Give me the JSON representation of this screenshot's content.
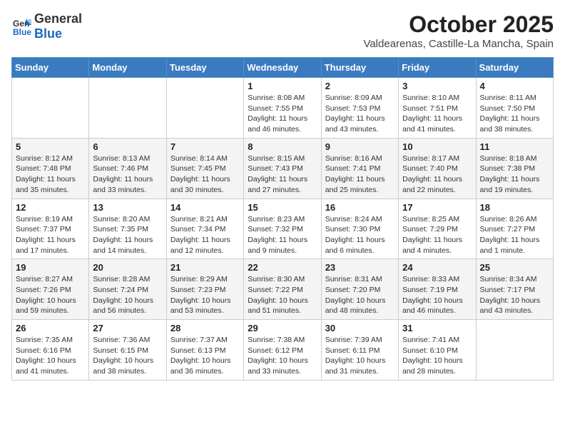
{
  "header": {
    "logo": {
      "general": "General",
      "blue": "Blue"
    },
    "month_title": "October 2025",
    "subtitle": "Valdearenas, Castille-La Mancha, Spain"
  },
  "weekdays": [
    "Sunday",
    "Monday",
    "Tuesday",
    "Wednesday",
    "Thursday",
    "Friday",
    "Saturday"
  ],
  "weeks": [
    [
      {
        "day": "",
        "info": ""
      },
      {
        "day": "",
        "info": ""
      },
      {
        "day": "",
        "info": ""
      },
      {
        "day": "1",
        "info": "Sunrise: 8:08 AM\nSunset: 7:55 PM\nDaylight: 11 hours\nand 46 minutes."
      },
      {
        "day": "2",
        "info": "Sunrise: 8:09 AM\nSunset: 7:53 PM\nDaylight: 11 hours\nand 43 minutes."
      },
      {
        "day": "3",
        "info": "Sunrise: 8:10 AM\nSunset: 7:51 PM\nDaylight: 11 hours\nand 41 minutes."
      },
      {
        "day": "4",
        "info": "Sunrise: 8:11 AM\nSunset: 7:50 PM\nDaylight: 11 hours\nand 38 minutes."
      }
    ],
    [
      {
        "day": "5",
        "info": "Sunrise: 8:12 AM\nSunset: 7:48 PM\nDaylight: 11 hours\nand 35 minutes."
      },
      {
        "day": "6",
        "info": "Sunrise: 8:13 AM\nSunset: 7:46 PM\nDaylight: 11 hours\nand 33 minutes."
      },
      {
        "day": "7",
        "info": "Sunrise: 8:14 AM\nSunset: 7:45 PM\nDaylight: 11 hours\nand 30 minutes."
      },
      {
        "day": "8",
        "info": "Sunrise: 8:15 AM\nSunset: 7:43 PM\nDaylight: 11 hours\nand 27 minutes."
      },
      {
        "day": "9",
        "info": "Sunrise: 8:16 AM\nSunset: 7:41 PM\nDaylight: 11 hours\nand 25 minutes."
      },
      {
        "day": "10",
        "info": "Sunrise: 8:17 AM\nSunset: 7:40 PM\nDaylight: 11 hours\nand 22 minutes."
      },
      {
        "day": "11",
        "info": "Sunrise: 8:18 AM\nSunset: 7:38 PM\nDaylight: 11 hours\nand 19 minutes."
      }
    ],
    [
      {
        "day": "12",
        "info": "Sunrise: 8:19 AM\nSunset: 7:37 PM\nDaylight: 11 hours\nand 17 minutes."
      },
      {
        "day": "13",
        "info": "Sunrise: 8:20 AM\nSunset: 7:35 PM\nDaylight: 11 hours\nand 14 minutes."
      },
      {
        "day": "14",
        "info": "Sunrise: 8:21 AM\nSunset: 7:34 PM\nDaylight: 11 hours\nand 12 minutes."
      },
      {
        "day": "15",
        "info": "Sunrise: 8:23 AM\nSunset: 7:32 PM\nDaylight: 11 hours\nand 9 minutes."
      },
      {
        "day": "16",
        "info": "Sunrise: 8:24 AM\nSunset: 7:30 PM\nDaylight: 11 hours\nand 6 minutes."
      },
      {
        "day": "17",
        "info": "Sunrise: 8:25 AM\nSunset: 7:29 PM\nDaylight: 11 hours\nand 4 minutes."
      },
      {
        "day": "18",
        "info": "Sunrise: 8:26 AM\nSunset: 7:27 PM\nDaylight: 11 hours\nand 1 minute."
      }
    ],
    [
      {
        "day": "19",
        "info": "Sunrise: 8:27 AM\nSunset: 7:26 PM\nDaylight: 10 hours\nand 59 minutes."
      },
      {
        "day": "20",
        "info": "Sunrise: 8:28 AM\nSunset: 7:24 PM\nDaylight: 10 hours\nand 56 minutes."
      },
      {
        "day": "21",
        "info": "Sunrise: 8:29 AM\nSunset: 7:23 PM\nDaylight: 10 hours\nand 53 minutes."
      },
      {
        "day": "22",
        "info": "Sunrise: 8:30 AM\nSunset: 7:22 PM\nDaylight: 10 hours\nand 51 minutes."
      },
      {
        "day": "23",
        "info": "Sunrise: 8:31 AM\nSunset: 7:20 PM\nDaylight: 10 hours\nand 48 minutes."
      },
      {
        "day": "24",
        "info": "Sunrise: 8:33 AM\nSunset: 7:19 PM\nDaylight: 10 hours\nand 46 minutes."
      },
      {
        "day": "25",
        "info": "Sunrise: 8:34 AM\nSunset: 7:17 PM\nDaylight: 10 hours\nand 43 minutes."
      }
    ],
    [
      {
        "day": "26",
        "info": "Sunrise: 7:35 AM\nSunset: 6:16 PM\nDaylight: 10 hours\nand 41 minutes."
      },
      {
        "day": "27",
        "info": "Sunrise: 7:36 AM\nSunset: 6:15 PM\nDaylight: 10 hours\nand 38 minutes."
      },
      {
        "day": "28",
        "info": "Sunrise: 7:37 AM\nSunset: 6:13 PM\nDaylight: 10 hours\nand 36 minutes."
      },
      {
        "day": "29",
        "info": "Sunrise: 7:38 AM\nSunset: 6:12 PM\nDaylight: 10 hours\nand 33 minutes."
      },
      {
        "day": "30",
        "info": "Sunrise: 7:39 AM\nSunset: 6:11 PM\nDaylight: 10 hours\nand 31 minutes."
      },
      {
        "day": "31",
        "info": "Sunrise: 7:41 AM\nSunset: 6:10 PM\nDaylight: 10 hours\nand 28 minutes."
      },
      {
        "day": "",
        "info": ""
      }
    ]
  ]
}
